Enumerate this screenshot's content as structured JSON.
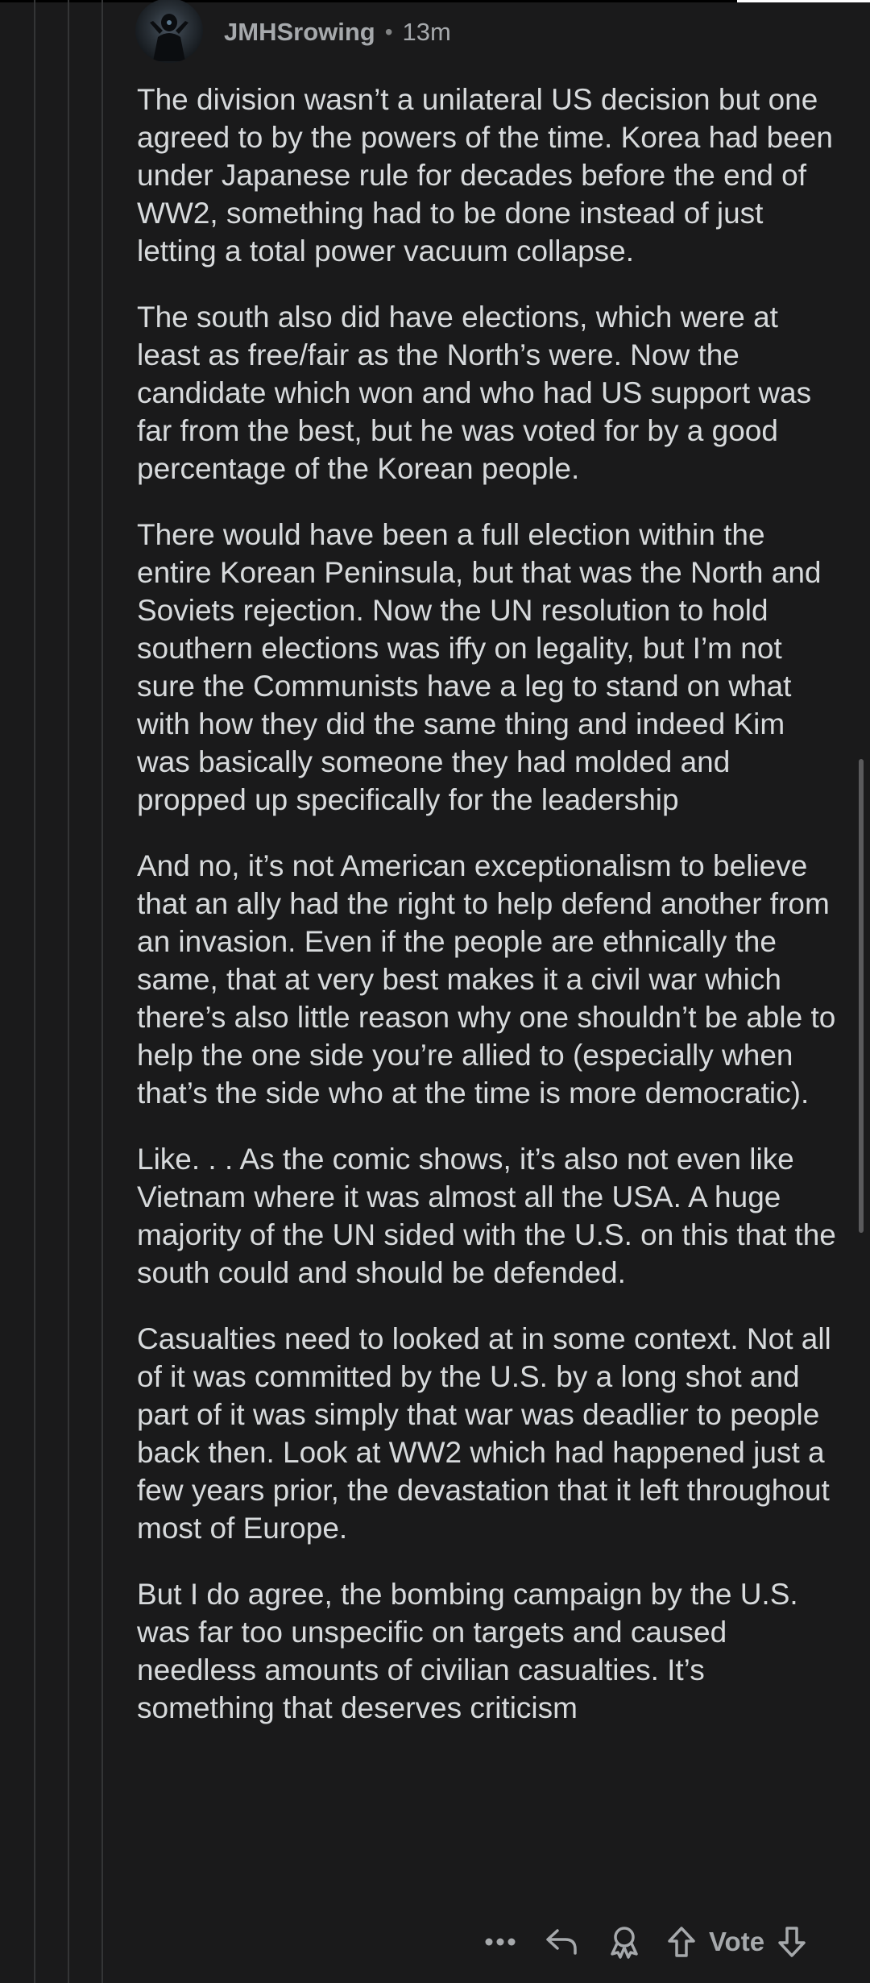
{
  "comment": {
    "username": "JMHSrowing",
    "separator": "•",
    "time_ago": "13m",
    "paragraphs": [
      "The division wasn’t a unilateral US decision but one agreed to by the powers of the time. Korea had been under Japanese rule for decades before the end of WW2, something had to be done instead of just letting a total power vacuum collapse.",
      "The south also did have elections, which were at least as free/fair as the North’s were. Now the candidate which won and who had US support was far from the best, but he was voted for by a good percentage of the Korean people.",
      "There would have been a full election within the entire Korean Peninsula, but that was the North and Soviets rejection. Now the UN resolution to hold southern elections was iffy on legality, but I’m not sure the Communists have a leg to stand on what with how they did the same thing and indeed Kim was basically someone they had molded and propped up specifically for the leadership",
      "And no, it’s not American exceptionalism to believe that an ally had the right to help defend another from an invasion. Even if the people are ethnically the same, that at very best makes it a civil war which there’s also little reason why one shouldn’t be able to help the one side you’re allied to (especially when that’s the side who at the time is more democratic).",
      "Like. . . As the comic shows, it’s also not even like Vietnam where it was almost all the USA. A huge majority of the UN sided with the U.S. on this that the south could and should be defended.",
      "Casualties need to looked at in some context. Not all of it was committed by the U.S. by a long shot and part of it was simply that war was deadlier to people back then. Look at WW2 which had happened just a few years prior, the devastation that it left throughout most of Europe.",
      "But I do agree, the bombing campaign by the U.S. was far too unspecific on targets and caused needless amounts of civilian casualties. It’s something that deserves criticism"
    ]
  },
  "actions": {
    "more_icon": "more-horizontal-icon",
    "reply_icon": "reply-icon",
    "award_icon": "award-icon",
    "upvote_icon": "upvote-arrow-icon",
    "vote_label": "Vote",
    "downvote_icon": "downvote-arrow-icon"
  },
  "colors": {
    "background": "#1a1a1b",
    "text": "#d7dadc",
    "muted": "#a6a9ac",
    "thread_line": "#343536"
  }
}
